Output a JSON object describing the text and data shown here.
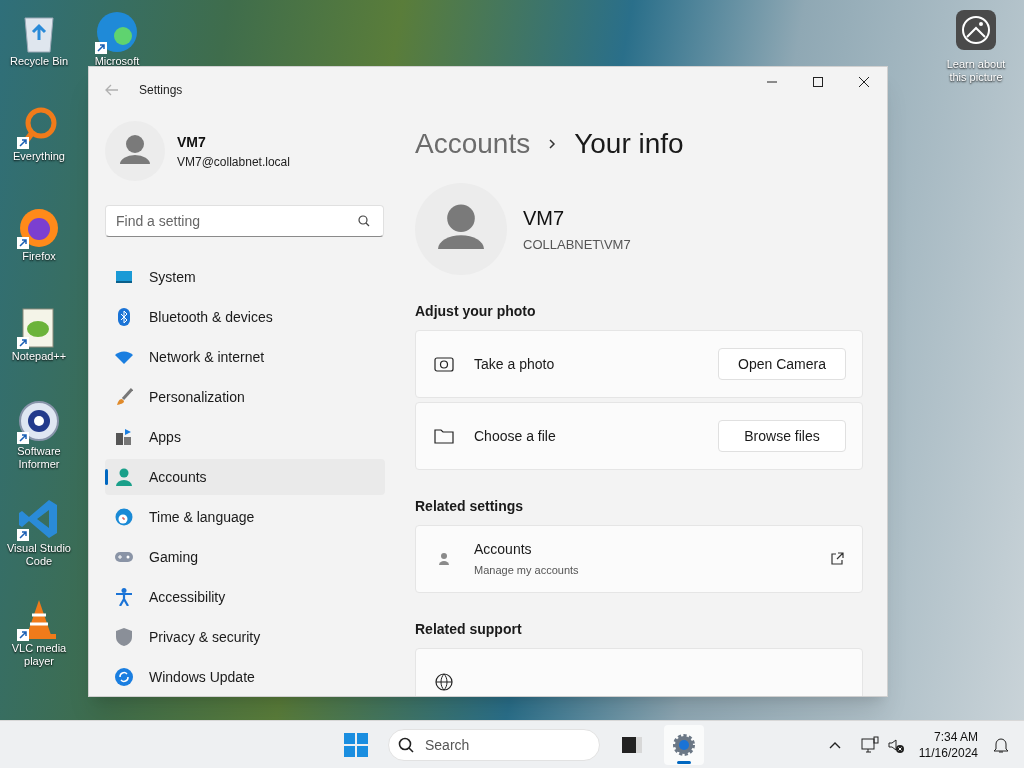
{
  "desktop_icons": [
    {
      "label": "Recycle Bin",
      "kind": "recycle",
      "shortcut": false
    },
    {
      "label": "Microsoft",
      "kind": "edge",
      "shortcut": true
    },
    {
      "label": "Everything",
      "kind": "everything",
      "shortcut": true
    },
    {
      "label": "Firefox",
      "kind": "firefox",
      "shortcut": true
    },
    {
      "label": "Notepad++",
      "kind": "notepad",
      "shortcut": true
    },
    {
      "label": "Software Informer",
      "kind": "informer",
      "shortcut": true
    },
    {
      "label": "Visual Studio Code",
      "kind": "vscode",
      "shortcut": true
    },
    {
      "label": "VLC media player",
      "kind": "vlc",
      "shortcut": true
    }
  ],
  "wallpaper_button": {
    "label": "Learn about this picture"
  },
  "window": {
    "title": "Settings",
    "user": {
      "name": "VM7",
      "email": "VM7@collabnet.local"
    },
    "search": {
      "placeholder": "Find a setting"
    },
    "nav": [
      {
        "label": "System",
        "kind": "system",
        "selected": false
      },
      {
        "label": "Bluetooth & devices",
        "kind": "bluetooth",
        "selected": false
      },
      {
        "label": "Network & internet",
        "kind": "network",
        "selected": false
      },
      {
        "label": "Personalization",
        "kind": "brush",
        "selected": false
      },
      {
        "label": "Apps",
        "kind": "apps",
        "selected": false
      },
      {
        "label": "Accounts",
        "kind": "accounts",
        "selected": true
      },
      {
        "label": "Time & language",
        "kind": "time",
        "selected": false
      },
      {
        "label": "Gaming",
        "kind": "gaming",
        "selected": false
      },
      {
        "label": "Accessibility",
        "kind": "accessibility",
        "selected": false
      },
      {
        "label": "Privacy & security",
        "kind": "privacy",
        "selected": false
      },
      {
        "label": "Windows Update",
        "kind": "update",
        "selected": false
      }
    ],
    "breadcrumb": [
      "Accounts",
      "Your info"
    ],
    "profile": {
      "name": "VM7",
      "domain": "COLLABNET\\VM7"
    },
    "sections": [
      {
        "heading": "Adjust your photo",
        "rows": [
          {
            "kind": "camera",
            "label": "Take a photo",
            "button": "Open Camera"
          },
          {
            "kind": "folder",
            "label": "Choose a file",
            "button": "Browse files"
          }
        ]
      },
      {
        "heading": "Related settings",
        "rows": [
          {
            "kind": "link",
            "label": "Accounts",
            "sub": "Manage my accounts"
          }
        ]
      },
      {
        "heading": "Related support",
        "rows": [
          {
            "kind": "globe"
          }
        ]
      }
    ]
  },
  "taskbar": {
    "search_placeholder": "Search",
    "apps": [
      {
        "kind": "terminal",
        "selected": false
      },
      {
        "kind": "settings",
        "selected": true
      }
    ],
    "time": "7:34 AM",
    "date": "11/16/2024"
  }
}
